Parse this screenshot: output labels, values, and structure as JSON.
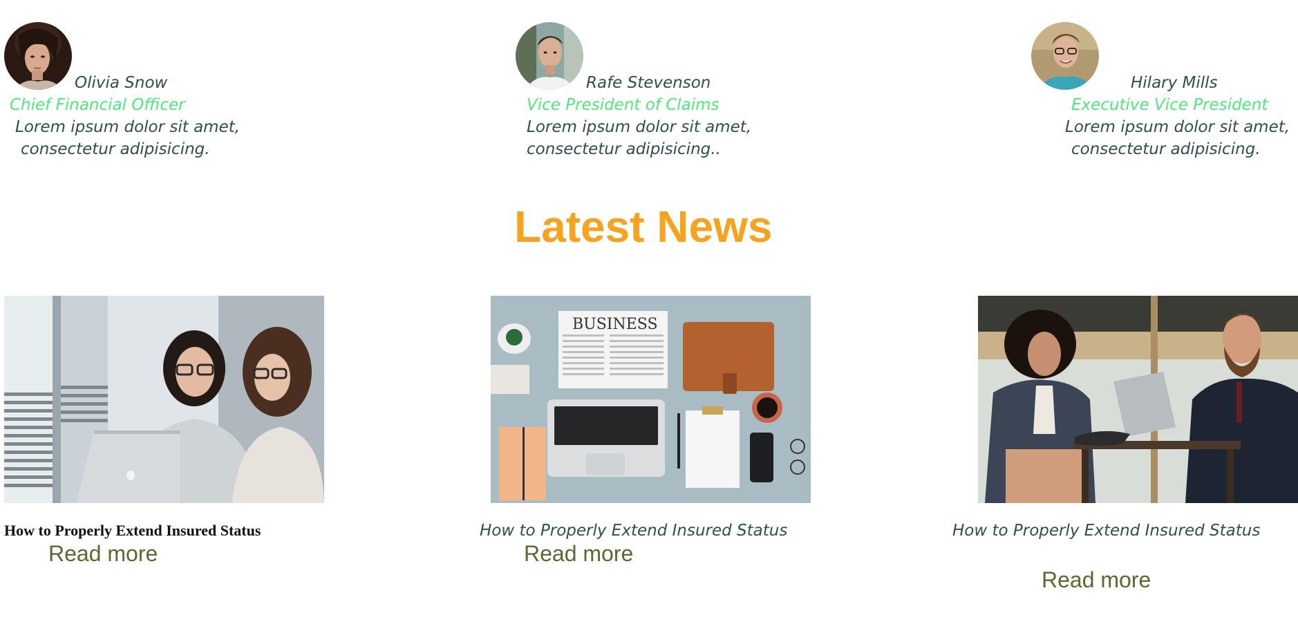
{
  "team": [
    {
      "name": "Olivia Snow",
      "role": "Chief Financial Officer",
      "desc_line1": "Lorem ipsum dolor sit amet,",
      "desc_line2": "consectetur adipisicing."
    },
    {
      "name": "Rafe Stevenson",
      "role": "Vice President of Claims",
      "desc_line1": "Lorem ipsum dolor sit amet,",
      "desc_line2": "consectetur adipisicing.."
    },
    {
      "name": "Hilary Mills",
      "role": "Executive Vice President",
      "desc_line1": "Lorem ipsum dolor sit amet,",
      "desc_line2": "consectetur adipisicing."
    }
  ],
  "news": {
    "title": "Latest News",
    "items": [
      {
        "headline": "How to Properly Extend Insured Status",
        "link": "Read more"
      },
      {
        "headline": "How to Properly Extend Insured Status",
        "link": "Read more"
      },
      {
        "headline": "How to Properly Extend Insured Status",
        "link": "Read more"
      }
    ],
    "newspaper_text": "BUSINESS"
  },
  "colors": {
    "heading": "#f6a31f",
    "name": "#2f4f4f",
    "role": "#4fe87a",
    "link": "#556b2f"
  }
}
